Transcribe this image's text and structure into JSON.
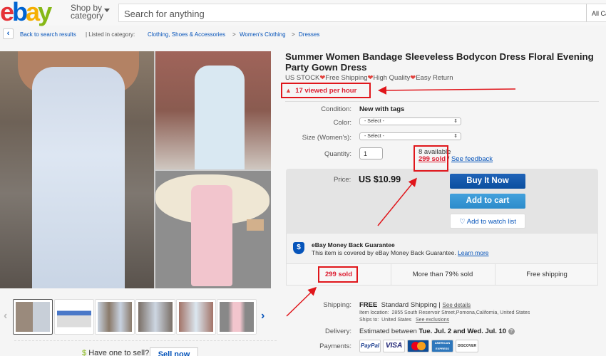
{
  "header": {
    "logo_letters": [
      "e",
      "b",
      "a",
      "y"
    ],
    "shop_by_line1": "Shop by",
    "shop_by_line2": "category",
    "search_placeholder": "Search for anything",
    "category_select": "All Categories"
  },
  "breadcrumb": {
    "back_label": "Back to search results",
    "listed_in": "| Listed in category:",
    "items": [
      "Clothing, Shoes & Accessories",
      "Women's Clothing",
      "Dresses"
    ],
    "separator": ">"
  },
  "gallery": {
    "thumbnail_count": 6,
    "prev_icon": "chevron-left-icon",
    "next_icon": "chevron-right-icon"
  },
  "sell_row": {
    "text": "Have one to sell?",
    "button": "Sell now"
  },
  "product": {
    "title": "Summer Women Bandage Sleeveless Bodycon Dress Floral Evening Party Gown Dress",
    "subtitle_parts": [
      "US STOCK",
      "Free Shipping",
      "High Quality",
      "Easy Return"
    ],
    "viewed": "17 viewed per hour",
    "condition_label": "Condition:",
    "condition_value": "New with tags",
    "color_label": "Color:",
    "color_value": "- Select -",
    "size_label": "Size (Women's):",
    "size_value": "- Select -",
    "quantity_label": "Quantity:",
    "quantity_value": "1",
    "available": "8 available",
    "sold": "299 sold",
    "sold_sep": " / ",
    "feedback": "See feedback"
  },
  "buybox": {
    "price_label": "Price:",
    "price": "US $10.99",
    "buy_now": "Buy It Now",
    "add_to_cart": "Add to cart",
    "watch": "Add to watch list",
    "colors": {
      "buy": "#0b4f9f",
      "cart": "#2c8ccb",
      "link": "#0654ba",
      "alert": "#dd1e31"
    }
  },
  "guarantee": {
    "title": "eBay Money Back Guarantee",
    "text": "This item is covered by eBay Money Back Guarantee.",
    "link": "Learn more"
  },
  "stats": [
    "299 sold",
    "More than 79% sold",
    "Free shipping"
  ],
  "shipping": {
    "label": "Shipping:",
    "free": "FREE",
    "method": "Standard Shipping",
    "details_link": "See details",
    "location_label": "Item location:",
    "location": "2855 South Reservoir Street,Pomona,California, United States",
    "ships_to_label": "Ships to:",
    "ships_to": "United States",
    "exclusions_link": "See exclusions"
  },
  "delivery": {
    "label": "Delivery:",
    "prefix": "Estimated between ",
    "range": "Tue. Jul. 2 and Wed. Jul. 10"
  },
  "payments": {
    "label": "Payments:",
    "methods": [
      "PayPal",
      "VISA",
      "MasterCard",
      "AMERICAN EXPRESS",
      "DISCOVER"
    ]
  }
}
